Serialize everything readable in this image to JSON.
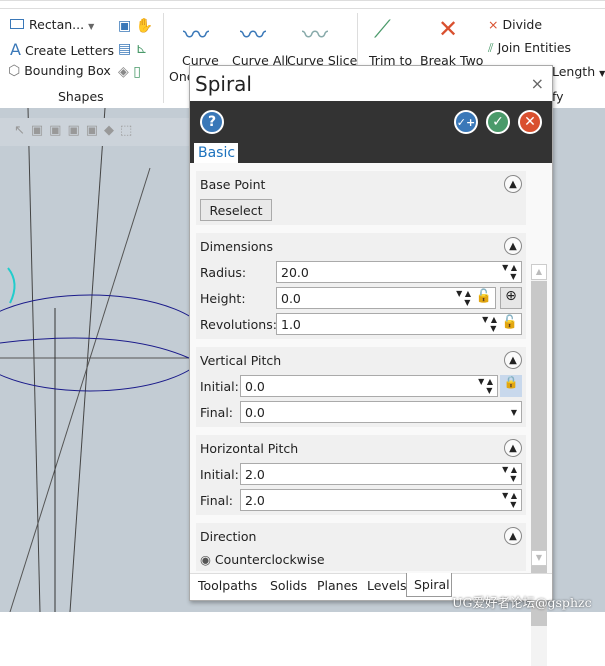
{
  "ribbon": {
    "shapes": {
      "items": [
        "Rectan...",
        "Create Letters",
        "Bounding Box"
      ],
      "group_label": "Shapes"
    },
    "surfaces": [
      "Curve",
      "Curve All",
      "Curve Slice"
    ],
    "surface_partial": "One",
    "modify": {
      "trim": "Trim to",
      "break": "Break Two",
      "divide": "Divide",
      "join": "Join Entities",
      "length": "Length",
      "group_partial": "fy"
    }
  },
  "dialog": {
    "title": "Spiral",
    "close": "×",
    "tab": "Basic",
    "base_point": {
      "header": "Base Point",
      "button": "Reselect"
    },
    "dimensions": {
      "header": "Dimensions",
      "radius_label": "Radius:",
      "radius": "20.0",
      "height_label": "Height:",
      "height": "0.0",
      "revolutions_label": "Revolutions:",
      "revolutions": "1.0"
    },
    "vertical_pitch": {
      "header": "Vertical Pitch",
      "initial_label": "Initial:",
      "initial": "0.0",
      "final_label": "Final:",
      "final": "0.0"
    },
    "horizontal_pitch": {
      "header": "Horizontal Pitch",
      "initial_label": "Initial:",
      "initial": "2.0",
      "final_label": "Final:",
      "final": "2.0"
    },
    "direction": {
      "header": "Direction",
      "option": "Counterclockwise",
      "selected": true
    },
    "bottom_tabs": [
      "Toolpaths",
      "Solids",
      "Planes",
      "Levels",
      "Spiral"
    ],
    "active_bottom_tab": "Spiral",
    "colors": {
      "help": "#3a78b8",
      "ok_add": "#3a78b8",
      "ok": "#4a9a6a",
      "cancel": "#d9502f"
    }
  },
  "watermark": "UG爱好者论坛@gsphzc"
}
